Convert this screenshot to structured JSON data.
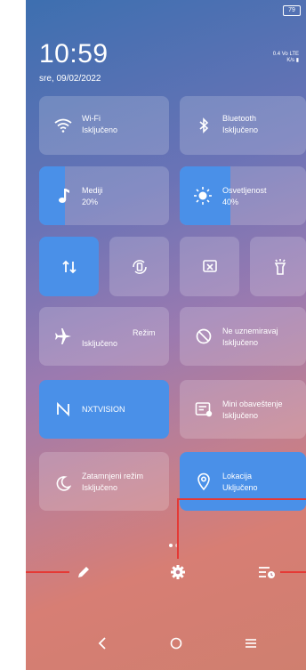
{
  "status": {
    "battery": "79"
  },
  "header": {
    "time": "10:59",
    "date": "sre, 09/02/2022",
    "net_speed": "0.4",
    "net_unit": "K/s",
    "net_type": "Vo LTE"
  },
  "tiles": {
    "wifi": {
      "title": "Wi-Fi",
      "status": "Isključeno"
    },
    "bluetooth": {
      "title": "Bluetooth",
      "status": "Isključeno"
    },
    "media": {
      "title": "Mediji",
      "value": "20%",
      "level": 0.2
    },
    "brightness": {
      "title": "Osvetljenost",
      "value": "40%",
      "level": 0.4
    },
    "airplane": {
      "title": "Režim",
      "status": "Isključeno"
    },
    "dnd": {
      "title": "Ne uznemiravaj",
      "status": "Isključeno"
    },
    "nxtvision": {
      "title": "NXTVISION"
    },
    "mini_notif": {
      "title": "Mini obaveštenje",
      "status": "Isključeno"
    },
    "dark_mode": {
      "title": "Zatamnjeni režim",
      "status": "Isključeno"
    },
    "location": {
      "title": "Lokacija",
      "status": "Uključeno"
    }
  },
  "colors": {
    "accent": "#4a90e8",
    "callout": "#e53935"
  }
}
